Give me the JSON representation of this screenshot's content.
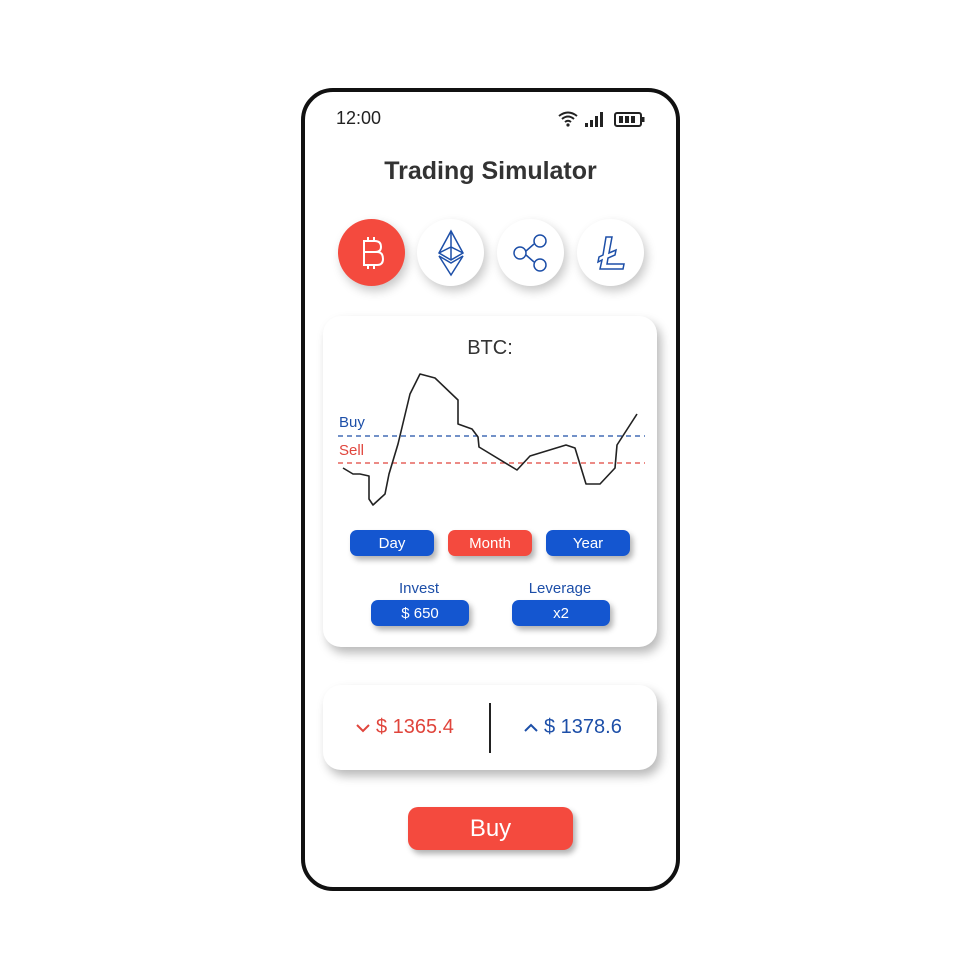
{
  "status_bar": {
    "time": "12:00",
    "icons": [
      "wifi-icon",
      "signal-icon",
      "battery-icon"
    ]
  },
  "header": {
    "title": "Trading Simulator"
  },
  "coins": [
    {
      "name": "bitcoin",
      "icon": "bitcoin-icon",
      "selected": true
    },
    {
      "name": "ethereum",
      "icon": "ethereum-icon",
      "selected": false
    },
    {
      "name": "ripple",
      "icon": "ripple-icon",
      "selected": false
    },
    {
      "name": "litecoin",
      "icon": "litecoin-icon",
      "selected": false
    }
  ],
  "chart": {
    "title": "BTC:",
    "buy_label": "Buy",
    "sell_label": "Sell"
  },
  "periods": [
    {
      "label": "Day",
      "selected": false
    },
    {
      "label": "Month",
      "selected": true
    },
    {
      "label": "Year",
      "selected": false
    }
  ],
  "invest": {
    "label": "Invest",
    "value": "$ 650"
  },
  "leverage": {
    "label": "Leverage",
    "value": "x2"
  },
  "prices": {
    "sell": "$ 1365.4",
    "buy": "$ 1378.6"
  },
  "actions": {
    "buy": "Buy"
  },
  "colors": {
    "accent_red": "#f44a3e",
    "accent_blue": "#1456d0"
  }
}
